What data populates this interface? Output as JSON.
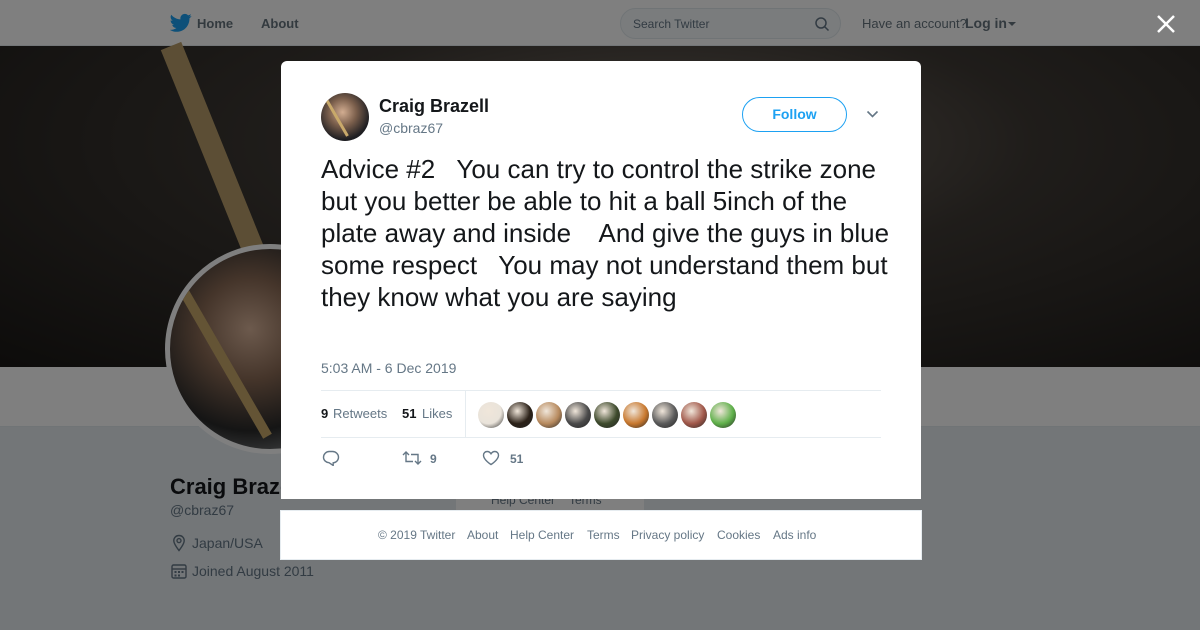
{
  "nav": {
    "home_label": "Home",
    "about_label": "About",
    "search_placeholder": "Search Twitter",
    "have_account": "Have an account?",
    "login_label": "Log in"
  },
  "profile": {
    "name": "Craig Brazell",
    "handle": "@cbraz67",
    "location": "Japan/USA",
    "joined": "Joined August 2011"
  },
  "background_footer": {
    "help_center": "Help Center",
    "terms": "Terms"
  },
  "tweet": {
    "author_name": "Craig Brazell",
    "author_handle": "@cbraz67",
    "follow_label": "Follow",
    "text": "Advice #2   You can try to control the strike zone but you better be able to hit a ball 5inch of the plate away and inside    And give the guys in blue some respect   You may not understand them but they know what you are saying",
    "timestamp": "5:03 AM - 6 Dec 2019",
    "retweets_count": "9",
    "retweets_label": "Retweets",
    "likes_count": "51",
    "likes_label": "Likes",
    "action_retweet_count": "9",
    "action_like_count": "51",
    "liker_colors": [
      "#e9e3da",
      "#2b2118",
      "#b78a5e",
      "#4a4a4a",
      "#3d4a2c",
      "#c8782e",
      "#5a5a5a",
      "#a1584a",
      "#5fb04a"
    ]
  },
  "footer": {
    "copyright": "© 2019 Twitter",
    "about": "About",
    "help_center": "Help Center",
    "terms": "Terms",
    "privacy": "Privacy policy",
    "cookies": "Cookies",
    "ads_info": "Ads info"
  },
  "colors": {
    "accent": "#1da1f2",
    "secondary_text": "#657786"
  }
}
